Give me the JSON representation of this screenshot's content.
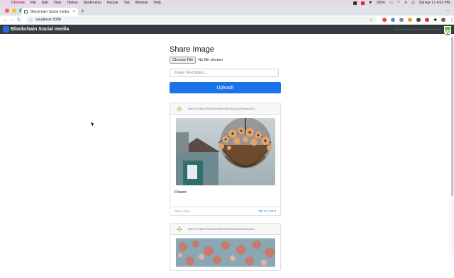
{
  "menubar": {
    "app": "Chrome",
    "items": [
      "File",
      "Edit",
      "View",
      "History",
      "Bookmarks",
      "People",
      "Tab",
      "Window",
      "Help"
    ],
    "battery": "100%",
    "datetime": "Sat Apr 17  4:02 PM"
  },
  "browser": {
    "tab_title": "Blockchain Social media",
    "url": "localhost:3000"
  },
  "navbar": {
    "brand": "Blockchain Social media",
    "account": "0x627f1f6076828f1f0c6f092846c8a914c5f0"
  },
  "form": {
    "title": "Share Image",
    "file_button": "Choose File",
    "file_status": "No file chosen",
    "description_placeholder": "Image description...",
    "upload_label": "Upload!"
  },
  "posts": [
    {
      "author": "0xE217F38379930281f0f2e0393284aC6A194ac2410",
      "caption": "Flower",
      "tips": "TIPS: 0 ETH",
      "tip_button": "TIP 0.1 ETH"
    },
    {
      "author": "0xE217F38379930281f0f2e0393284aC6A194ac2410"
    }
  ],
  "colors": {
    "navbar": "#343a40",
    "accent": "#1a73e8",
    "identicon": "#6bc04b"
  }
}
